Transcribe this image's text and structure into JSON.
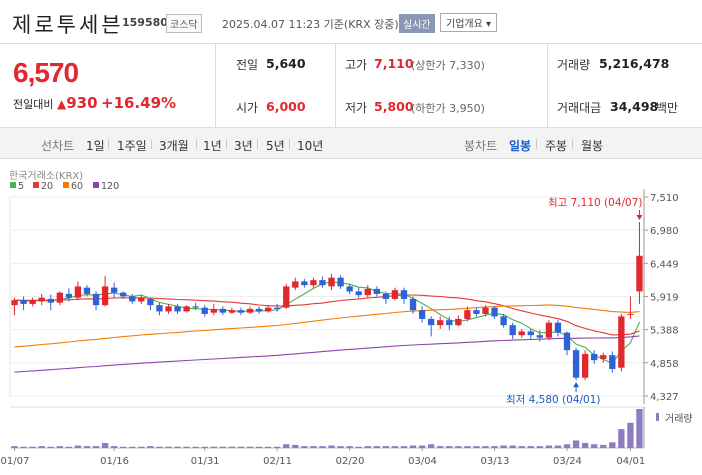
{
  "stock": {
    "name": "제로투세븐",
    "code": "159580",
    "market": "코스닥",
    "timestamp": "2025.04.07 11:23 기준(KRX 장중)",
    "realtime_label": "실시간",
    "company_label": "기업개요 ▾"
  },
  "quote": {
    "price": "6,570",
    "change_label": "전일대비",
    "change_arrow": "▲",
    "change_value": "930",
    "change_percent": "+16.49%",
    "prev_close_label": "전일",
    "prev_close": "5,640",
    "open_label": "시가",
    "open": "6,000",
    "high_label": "고가",
    "high": "7,110",
    "upper_limit": "(상한가 7,330)",
    "low_label": "저가",
    "low": "5,800",
    "lower_limit": "(하한가 3,950)",
    "volume_label": "거래량",
    "volume": "5,216,478",
    "amount_label": "거래대금",
    "amount": "34,498",
    "amount_unit": "백만"
  },
  "tabs": {
    "line_chart": "선차트",
    "periods": [
      "1일",
      "1주일",
      "3개월",
      "1년",
      "3년",
      "5년",
      "10년"
    ],
    "candle_chart": "봉차트",
    "candle_periods": [
      "일봉",
      "주봉",
      "월봉"
    ],
    "active_candle": "일봉"
  },
  "chart_data": {
    "type": "candlestick",
    "source_label": "한국거래소(KRX)",
    "moving_averages": [
      {
        "name": "5",
        "color": "#4caf50"
      },
      {
        "name": "20",
        "color": "#e53935"
      },
      {
        "name": "60",
        "color": "#f57c00"
      },
      {
        "name": "120",
        "color": "#8e44ad"
      }
    ],
    "y_ticks": [
      "7,510",
      "6,980",
      "6,449",
      "5,919",
      "5,388",
      "4,858",
      "4,327"
    ],
    "ylim": [
      4327,
      7510
    ],
    "x_labels": [
      "01/07",
      "01/16",
      "01/31",
      "02/11",
      "02/20",
      "03/04",
      "03/13",
      "03/24",
      "04/01"
    ],
    "high_annotation": "최고 7,110 (04/07)",
    "low_annotation": "최저 4,580 (04/01)",
    "volume_label": "거래량",
    "candles": [
      [
        5780,
        5860,
        5620,
        5900
      ],
      [
        5860,
        5800,
        5700,
        5920
      ],
      [
        5800,
        5860,
        5760,
        5900
      ],
      [
        5840,
        5900,
        5780,
        5960
      ],
      [
        5880,
        5820,
        5700,
        5950
      ],
      [
        5820,
        5980,
        5780,
        6000
      ],
      [
        5960,
        5900,
        5840,
        6050
      ],
      [
        5900,
        6080,
        5860,
        6160
      ],
      [
        6060,
        5960,
        5920,
        6100
      ],
      [
        5960,
        5780,
        5700,
        6000
      ],
      [
        5780,
        6080,
        5760,
        6250
      ],
      [
        6060,
        5980,
        5900,
        6140
      ],
      [
        5980,
        5920,
        5880,
        6000
      ],
      [
        5920,
        5840,
        5800,
        5960
      ],
      [
        5840,
        5900,
        5800,
        5940
      ],
      [
        5880,
        5780,
        5700,
        5900
      ],
      [
        5780,
        5680,
        5620,
        5820
      ],
      [
        5680,
        5760,
        5640,
        5800
      ],
      [
        5760,
        5680,
        5640,
        5800
      ],
      [
        5680,
        5760,
        5660,
        5780
      ],
      [
        5760,
        5740,
        5700,
        5820
      ],
      [
        5740,
        5640,
        5600,
        5780
      ],
      [
        5660,
        5720,
        5620,
        5800
      ],
      [
        5720,
        5660,
        5620,
        5760
      ],
      [
        5660,
        5700,
        5640,
        5740
      ],
      [
        5700,
        5660,
        5620,
        5740
      ],
      [
        5660,
        5720,
        5640,
        5760
      ],
      [
        5720,
        5680,
        5640,
        5760
      ],
      [
        5680,
        5740,
        5660,
        5780
      ],
      [
        5740,
        5720,
        5680,
        5800
      ],
      [
        5740,
        6080,
        5720,
        6120
      ],
      [
        6060,
        6160,
        6020,
        6220
      ],
      [
        6160,
        6100,
        6060,
        6200
      ],
      [
        6100,
        6180,
        6060,
        6220
      ],
      [
        6180,
        6100,
        6060,
        6240
      ],
      [
        6080,
        6220,
        6020,
        6280
      ],
      [
        6220,
        6080,
        6040,
        6260
      ],
      [
        6080,
        6000,
        5960,
        6120
      ],
      [
        6000,
        5940,
        5900,
        6060
      ],
      [
        5940,
        6040,
        5900,
        6100
      ],
      [
        6040,
        5960,
        5920,
        6080
      ],
      [
        5960,
        5880,
        5800,
        6000
      ],
      [
        5880,
        6020,
        5860,
        6060
      ],
      [
        6020,
        5880,
        5800,
        6060
      ],
      [
        5880,
        5700,
        5640,
        5920
      ],
      [
        5700,
        5560,
        5500,
        5760
      ],
      [
        5560,
        5460,
        5280,
        5600
      ],
      [
        5460,
        5540,
        5400,
        5600
      ],
      [
        5540,
        5460,
        5380,
        5600
      ],
      [
        5460,
        5560,
        5440,
        5620
      ],
      [
        5560,
        5700,
        5520,
        5760
      ],
      [
        5700,
        5640,
        5600,
        5740
      ],
      [
        5640,
        5740,
        5600,
        5780
      ],
      [
        5740,
        5600,
        5560,
        5760
      ],
      [
        5600,
        5460,
        5420,
        5640
      ],
      [
        5460,
        5300,
        5240,
        5500
      ],
      [
        5300,
        5360,
        5260,
        5400
      ],
      [
        5360,
        5300,
        5240,
        5400
      ],
      [
        5300,
        5260,
        5200,
        5380
      ],
      [
        5260,
        5500,
        5220,
        5540
      ],
      [
        5500,
        5340,
        5280,
        5540
      ],
      [
        5340,
        5060,
        4980,
        5360
      ],
      [
        5060,
        4620,
        4580,
        5100
      ],
      [
        4620,
        5000,
        4580,
        5060
      ],
      [
        5000,
        4900,
        4840,
        5060
      ],
      [
        4920,
        4980,
        4860,
        5020
      ],
      [
        4980,
        4760,
        4700,
        5040
      ],
      [
        4780,
        5600,
        4720,
        5640
      ],
      [
        5640,
        5640,
        5560,
        5920
      ],
      [
        6000,
        6570,
        5800,
        7110
      ]
    ],
    "volumes": [
      3,
      2,
      2,
      3,
      2,
      3,
      2,
      4,
      3,
      3,
      8,
      3,
      2,
      2,
      2,
      3,
      2,
      2,
      2,
      2,
      2,
      2,
      2,
      2,
      2,
      2,
      2,
      2,
      2,
      2,
      6,
      5,
      3,
      3,
      3,
      4,
      3,
      3,
      2,
      3,
      3,
      3,
      3,
      3,
      4,
      4,
      6,
      3,
      3,
      3,
      3,
      3,
      3,
      3,
      4,
      4,
      3,
      3,
      3,
      4,
      4,
      6,
      12,
      8,
      6,
      5,
      9,
      30,
      40,
      62
    ]
  }
}
